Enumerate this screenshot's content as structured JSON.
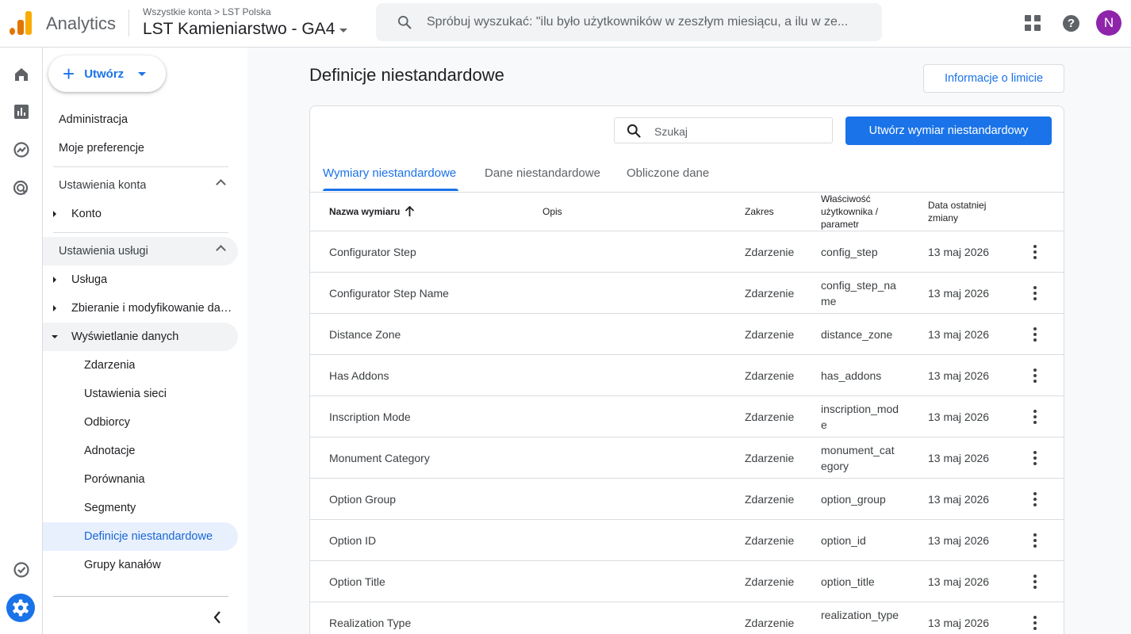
{
  "header": {
    "app_name": "Analytics",
    "breadcrumb": "Wszystkie konta > LST Polska",
    "property": "LST Kamieniarstwo - GA4",
    "search_placeholder": "Spróbuj wyszukać: \"ilu było użytkowników w zeszłym miesiącu, a ilu w ze...",
    "avatar_letter": "N",
    "accent_color": "#1a73e8",
    "avatar_color": "#8e24aa"
  },
  "rail": {
    "icons": [
      "home-icon",
      "reports-icon",
      "explore-icon",
      "advertising-icon",
      "check-circle-icon",
      "admin-gear-icon"
    ]
  },
  "nav": {
    "create_label": "Utwórz",
    "admin": "Administracja",
    "preferences": "Moje preferencje",
    "account_settings": "Ustawienia konta",
    "account": "Konto",
    "service_settings": "Ustawienia usługi",
    "service": "Usługa",
    "collection": "Zbieranie i modyfikowanie danych",
    "data_display": "Wyświetlanie danych",
    "sub_items": [
      "Zdarzenia",
      "Ustawienia sieci",
      "Odbiorcy",
      "Adnotacje",
      "Porównania",
      "Segmenty",
      "Definicje niestandardowe",
      "Grupy kanałów"
    ]
  },
  "main": {
    "title": "Definicje niestandardowe",
    "limits_button": "Informacje o limicie",
    "search_placeholder": "Szukaj",
    "create_button": "Utwórz wymiar niestandardowy",
    "tabs": [
      "Wymiary niestandardowe",
      "Dane niestandardowe",
      "Obliczone dane"
    ],
    "columns": {
      "name": "Nazwa wymiaru",
      "desc": "Opis",
      "scope": "Zakres",
      "param_line1": "Właściwość",
      "param_line2": "użytkownika /",
      "param_line3": "parametr",
      "date_line1": "Data ostatniej",
      "date_line2": "zmiany"
    },
    "rows": [
      {
        "name": "Configurator Step",
        "scope": "Zdarzenie",
        "param": "config_step",
        "date": "13 maj 2026"
      },
      {
        "name": "Configurator Step Name",
        "scope": "Zdarzenie",
        "param": "config_step_name",
        "date": "13 maj 2026"
      },
      {
        "name": "Distance Zone",
        "scope": "Zdarzenie",
        "param": "distance_zone",
        "date": "13 maj 2026"
      },
      {
        "name": "Has Addons",
        "scope": "Zdarzenie",
        "param": "has_addons",
        "date": "13 maj 2026"
      },
      {
        "name": "Inscription Mode",
        "scope": "Zdarzenie",
        "param": "inscription_mode",
        "date": "13 maj 2026"
      },
      {
        "name": "Monument Category",
        "scope": "Zdarzenie",
        "param": "monument_category",
        "date": "13 maj 2026"
      },
      {
        "name": "Option Group",
        "scope": "Zdarzenie",
        "param": "option_group",
        "date": "13 maj 2026"
      },
      {
        "name": "Option ID",
        "scope": "Zdarzenie",
        "param": "option_id",
        "date": "13 maj 2026"
      },
      {
        "name": "Option Title",
        "scope": "Zdarzenie",
        "param": "option_title",
        "date": "13 maj 2026"
      },
      {
        "name": "Realization Type",
        "scope": "Zdarzenie",
        "param": "realization_type",
        "date": "13 maj 2026"
      }
    ]
  }
}
